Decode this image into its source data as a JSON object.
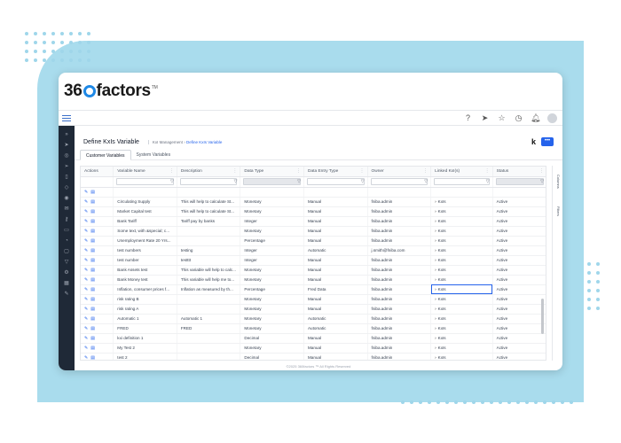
{
  "brand": {
    "logo_prefix": "36",
    "logo_suffix": "factors",
    "logo_tm": "TM"
  },
  "topbar": {
    "icons": [
      "help-icon",
      "send-icon",
      "star-icon",
      "clock-icon",
      "bell-icon",
      "avatar"
    ]
  },
  "sidebar": {
    "icons": [
      "expand-icon",
      "send-icon",
      "layers-icon",
      "send-icon",
      "doc-icon",
      "shield-icon",
      "target-icon",
      "mail-icon",
      "key-icon",
      "document-icon",
      "bell-icon",
      "box-icon",
      "filter-icon",
      "gear-icon",
      "grid-icon",
      "edit-icon"
    ]
  },
  "page": {
    "title": "Define KxIs Variable",
    "breadcrumb_parent": "KxI Management",
    "breadcrumb_sep": "›",
    "breadcrumb_current": "Define KxIs Variable",
    "k_label": "k",
    "menu_label": "•••"
  },
  "tabs": [
    {
      "label": "Customer Variables",
      "active": true
    },
    {
      "label": "System Variables",
      "active": false
    }
  ],
  "grid": {
    "columns": [
      "Actions",
      "Variable Name",
      "Description",
      "Data Type",
      "Data Entry Type",
      "Owner",
      "Linked KxI(s)",
      "Status"
    ],
    "rows": [
      {
        "name": "",
        "description": "",
        "data_type": "",
        "entry": "",
        "owner": "",
        "linked": "",
        "status": ""
      },
      {
        "name": "Circulating Supply",
        "description": "This will help to calculate St...",
        "data_type": "Monetary",
        "entry": "Manual",
        "owner": "fniba.admin",
        "linked": "KxIs",
        "status": "Active"
      },
      {
        "name": "Market Capital test",
        "description": "This will help to calculate St...",
        "data_type": "Monetary",
        "entry": "Manual",
        "owner": "fniba.admin",
        "linked": "KxIs",
        "status": "Active"
      },
      {
        "name": "Bank Tariff",
        "description": "Tariff pay by banks",
        "data_type": "Integer",
        "entry": "Manual",
        "owner": "fniba.admin",
        "linked": "KxIs",
        "status": "Active"
      },
      {
        "name": "Some text, with &special; c...",
        "description": "",
        "data_type": "Monetary",
        "entry": "Manual",
        "owner": "fniba.admin",
        "linked": "KxIs",
        "status": "Active"
      },
      {
        "name": "Unemployment Rate 20 Yrs...",
        "description": "",
        "data_type": "Percentage",
        "entry": "Manual",
        "owner": "fniba.admin",
        "linked": "KxIs",
        "status": "Active"
      },
      {
        "name": "test numbers",
        "description": "testing",
        "data_type": "Integer",
        "entry": "Automatic",
        "owner": "j.smith@fniba.com",
        "linked": "KxIs",
        "status": "Active"
      },
      {
        "name": "test number",
        "description": "testttt",
        "data_type": "Integer",
        "entry": "Manual",
        "owner": "fniba.admin",
        "linked": "KxIs",
        "status": "Active"
      },
      {
        "name": "Bank Assets test",
        "description": "This variable will help to calc...",
        "data_type": "Monetary",
        "entry": "Manual",
        "owner": "fniba.admin",
        "linked": "KxIs",
        "status": "Active"
      },
      {
        "name": "Bank Money test",
        "description": "This variable will help me to...",
        "data_type": "Monetary",
        "entry": "Manual",
        "owner": "fniba.admin",
        "linked": "KxIs",
        "status": "Active"
      },
      {
        "name": "Inflation, consumer prices f...",
        "description": "Inflation as measured by th...",
        "data_type": "Percentage",
        "entry": "Fred Data",
        "owner": "fniba.admin",
        "linked": "KxIs",
        "status": "Active"
      },
      {
        "name": "risk rating B",
        "description": "",
        "data_type": "Monetary",
        "entry": "Manual",
        "owner": "fniba.admin",
        "linked": "KxIs",
        "status": "Active"
      },
      {
        "name": "risk rating A",
        "description": "",
        "data_type": "Monetary",
        "entry": "Manual",
        "owner": "fniba.admin",
        "linked": "KxIs",
        "status": "Active"
      },
      {
        "name": "Automatic 1",
        "description": "Automatic 1",
        "data_type": "Monetary",
        "entry": "Automatic",
        "owner": "fniba.admin",
        "linked": "KxIs",
        "status": "Active"
      },
      {
        "name": "FRED",
        "description": "FRED",
        "data_type": "Monetary",
        "entry": "Automatic",
        "owner": "fniba.admin",
        "linked": "KxIs",
        "status": "Active"
      },
      {
        "name": "kxi definition 1",
        "description": "",
        "data_type": "Decimal",
        "entry": "Manual",
        "owner": "fniba.admin",
        "linked": "KxIs",
        "status": "Active"
      },
      {
        "name": "My Test 2",
        "description": "",
        "data_type": "Monetary",
        "entry": "Manual",
        "owner": "fniba.admin",
        "linked": "KxIs",
        "status": "Active"
      },
      {
        "name": "test 2",
        "description": "",
        "data_type": "Decimal",
        "entry": "Manual",
        "owner": "fniba.admin",
        "linked": "KxIs",
        "status": "Active"
      }
    ]
  },
  "rail": {
    "columns_label": "Columns",
    "filters_label": "Filters"
  },
  "footer": "©2025 360factors ™ All Rights Reserved",
  "colors": {
    "accent": "#2563eb",
    "sidebar": "#1f2937",
    "backdrop": "#a9dced"
  }
}
